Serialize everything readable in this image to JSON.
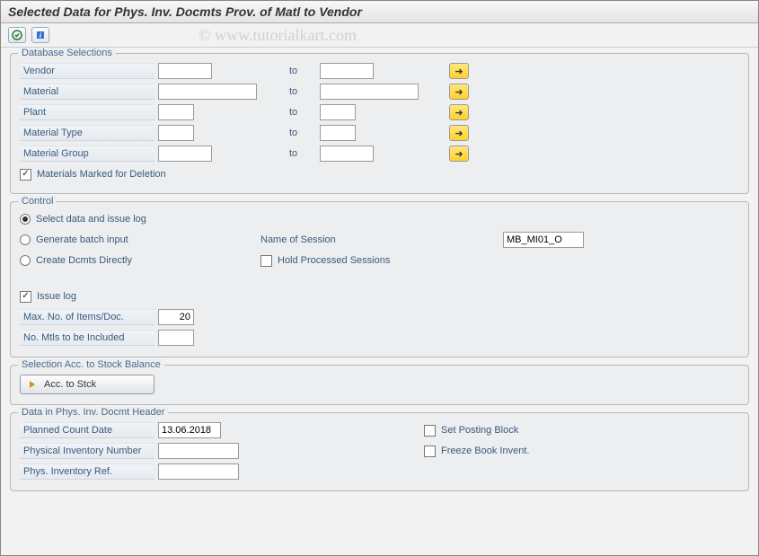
{
  "title": "Selected Data for Phys. Inv. Docmts Prov. of Matl to Vendor",
  "watermark": "© www.tutorialkart.com",
  "toolbar": {
    "execute_icon": "execute-icon",
    "info_icon": "info-icon"
  },
  "db": {
    "title": "Database Selections",
    "labels": {
      "vendor": "Vendor",
      "material": "Material",
      "plant": "Plant",
      "material_type": "Material Type",
      "material_group": "Material Group",
      "marked_deletion": "Materials Marked for Deletion"
    },
    "to": "to",
    "values": {
      "vendor_from": "",
      "vendor_to": "",
      "material_from": "",
      "material_to": "",
      "plant_from": "",
      "plant_to": "",
      "mtype_from": "",
      "mtype_to": "",
      "mgroup_from": "",
      "mgroup_to": ""
    },
    "marked_deletion_checked": "✓"
  },
  "ctrl": {
    "title": "Control",
    "radio": {
      "select_log": "Select data and issue log",
      "batch_input": "Generate batch input",
      "create_direct": "Create Dcmts Directly"
    },
    "session_label": "Name of Session",
    "session_value": "MB_MI01_O",
    "hold_sessions": "Hold Processed Sessions",
    "issue_log": "Issue log",
    "issue_log_checked": "✓",
    "max_items_label": "Max. No. of Items/Doc.",
    "max_items_value": "20",
    "no_mtls_label": "No. Mtls to be Included",
    "no_mtls_value": ""
  },
  "stock": {
    "title": "Selection Acc. to Stock Balance",
    "btn": "Acc. to Stck"
  },
  "header": {
    "title": "Data in Phys. Inv. Docmt Header",
    "planned_label": "Planned Count Date",
    "planned_value": "13.06.2018",
    "posting_block": "Set Posting Block",
    "pinv_no_label": "Physical Inventory Number",
    "pinv_no_value": "",
    "freeze": "Freeze Book Invent.",
    "pinv_ref_label": "Phys. Inventory Ref.",
    "pinv_ref_value": ""
  }
}
